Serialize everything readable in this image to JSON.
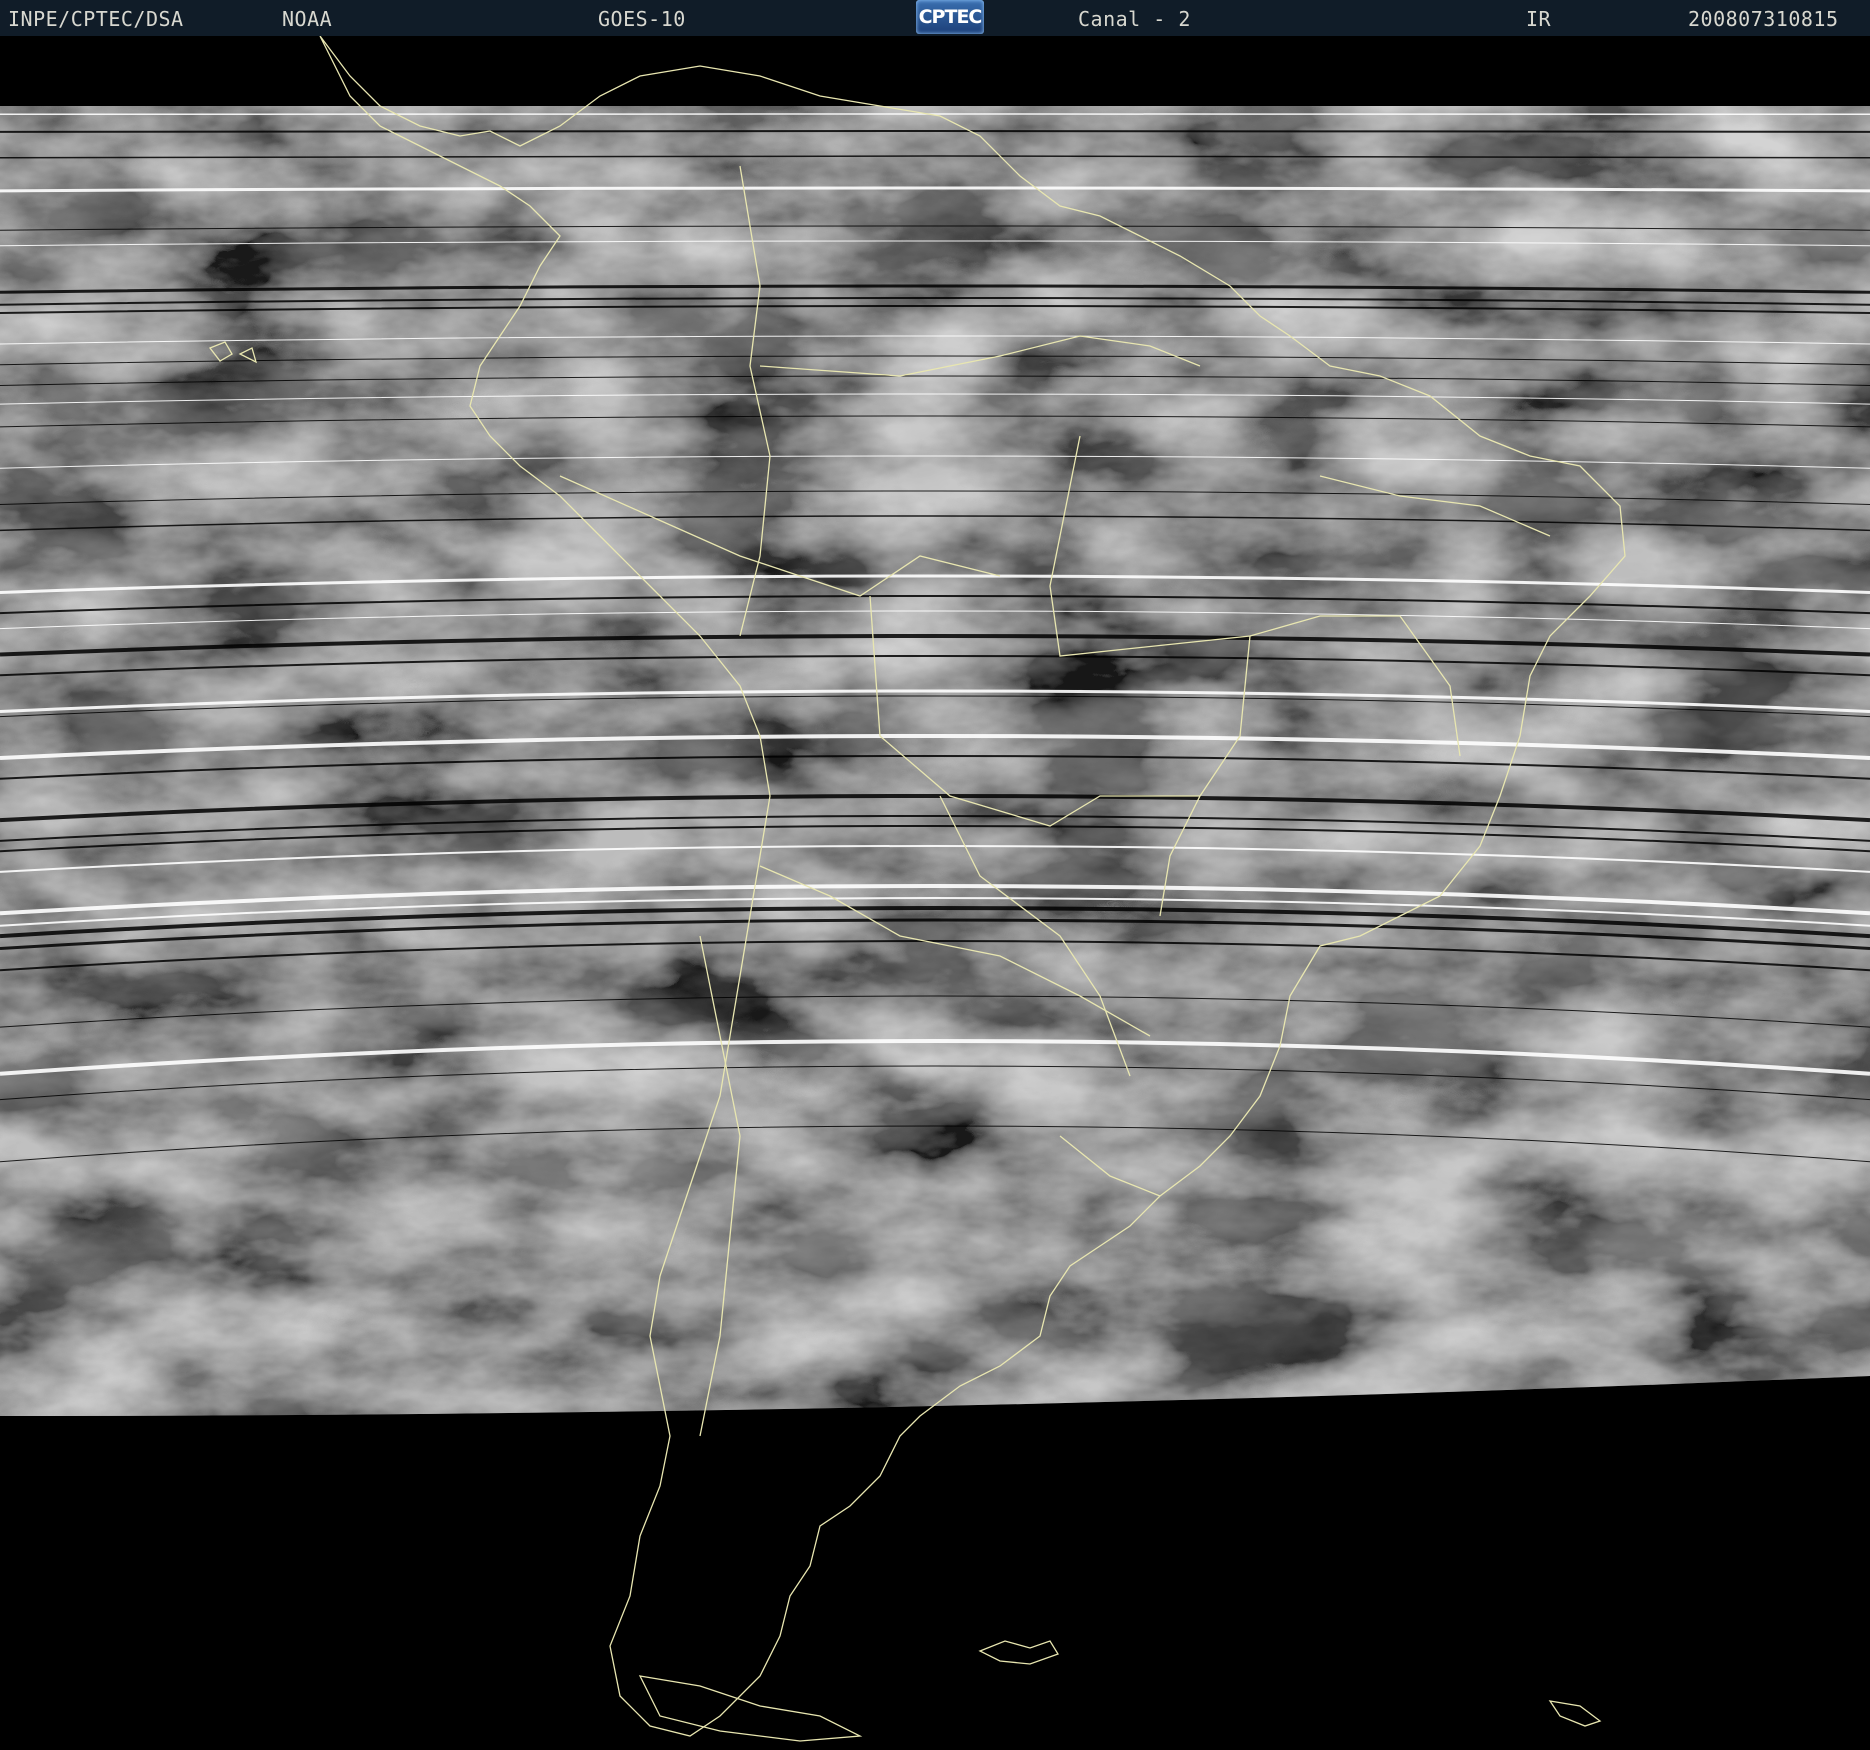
{
  "header": {
    "agency": "INPE/CPTEC/DSA",
    "operator": "NOAA",
    "satellite": "GOES-10",
    "logo_text": "CPTEC",
    "channel": "Canal - 2",
    "band": "IR",
    "timestamp": "200807310815"
  },
  "colors": {
    "header_background": "#101c28",
    "header_text": "#d8d8d0",
    "coastline": "#e8e6b0",
    "space": "#000000",
    "scan_line_bright": "#ffffff",
    "scan_line_dark": "#000000"
  },
  "map": {
    "region": "South America",
    "product": "infrared satellite imagery",
    "overlay": "coastlines and political borders"
  }
}
